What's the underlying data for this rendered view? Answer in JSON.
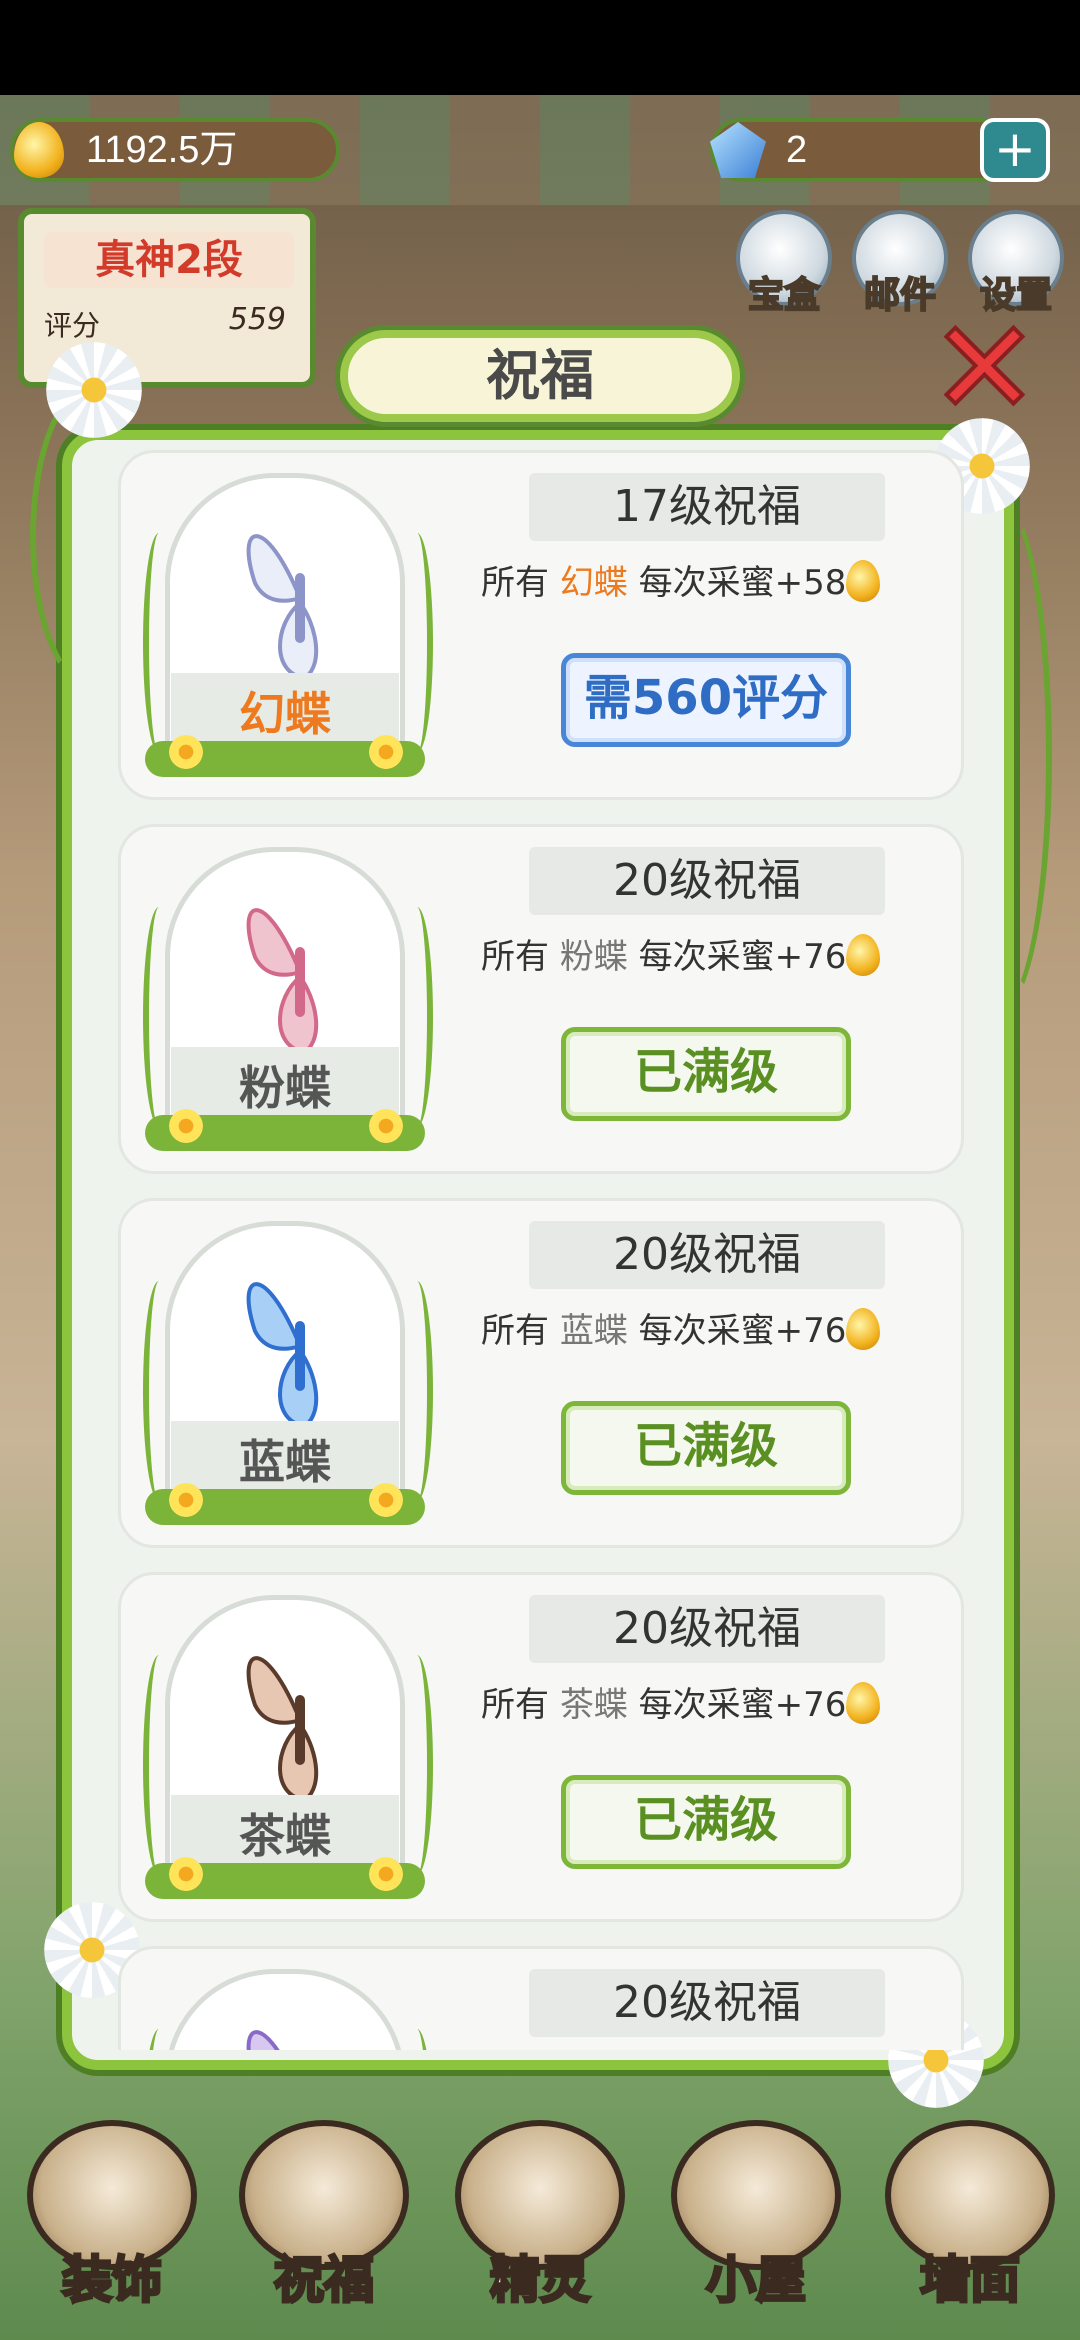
{
  "top_bar": {
    "honey_amount": "1192.5万",
    "gem_amount": "2",
    "plus_label": "+"
  },
  "rank": {
    "title": "真神2段",
    "score_label": "评分",
    "score_value": "559"
  },
  "top_icons": [
    {
      "label": "宝盒",
      "icon": "gift-box-icon"
    },
    {
      "label": "邮件",
      "icon": "mail-icon"
    },
    {
      "label": "设置",
      "icon": "gear-icon"
    }
  ],
  "dialog": {
    "title": "祝福",
    "close_label": "✕",
    "cards": [
      {
        "name": "幻蝶",
        "name_color": "#ee7a20",
        "level": "17级祝福",
        "desc_prefix": "所有",
        "desc_name": "幻蝶",
        "desc_suffix": "每次采蜜+58",
        "button": "需560评分",
        "button_style": "blue",
        "wing_colors": [
          "#e9eef8",
          "#8c94c8"
        ]
      },
      {
        "name": "粉蝶",
        "name_color": "#555555",
        "level": "20级祝福",
        "desc_prefix": "所有",
        "desc_name": "粉蝶",
        "desc_suffix": "每次采蜜+76",
        "button": "已满级",
        "button_style": "green",
        "wing_colors": [
          "#f0c4cf",
          "#d2698a"
        ]
      },
      {
        "name": "蓝蝶",
        "name_color": "#555555",
        "level": "20级祝福",
        "desc_prefix": "所有",
        "desc_name": "蓝蝶",
        "desc_suffix": "每次采蜜+76",
        "button": "已满级",
        "button_style": "green",
        "wing_colors": [
          "#a8cff5",
          "#2f6fd0"
        ]
      },
      {
        "name": "茶蝶",
        "name_color": "#555555",
        "level": "20级祝福",
        "desc_prefix": "所有",
        "desc_name": "茶蝶",
        "desc_suffix": "每次采蜜+76",
        "button": "已满级",
        "button_style": "green",
        "wing_colors": [
          "#e8c7b2",
          "#5a3a2a"
        ]
      },
      {
        "name": "",
        "name_color": "#555555",
        "level": "20级祝福",
        "desc_prefix": "",
        "desc_name": "",
        "desc_suffix": "",
        "button": "",
        "button_style": "green",
        "wing_colors": [
          "#d8c8f0",
          "#8a6ac8"
        ]
      }
    ]
  },
  "bottom_nav": [
    {
      "label": "装饰",
      "icon": "plant-icon"
    },
    {
      "label": "祝福",
      "icon": "butterfly-icon"
    },
    {
      "label": "精灵",
      "icon": "fairy-icon"
    },
    {
      "label": "小屋",
      "icon": "house-icon"
    },
    {
      "label": "墙面",
      "icon": "bell-icon"
    }
  ]
}
